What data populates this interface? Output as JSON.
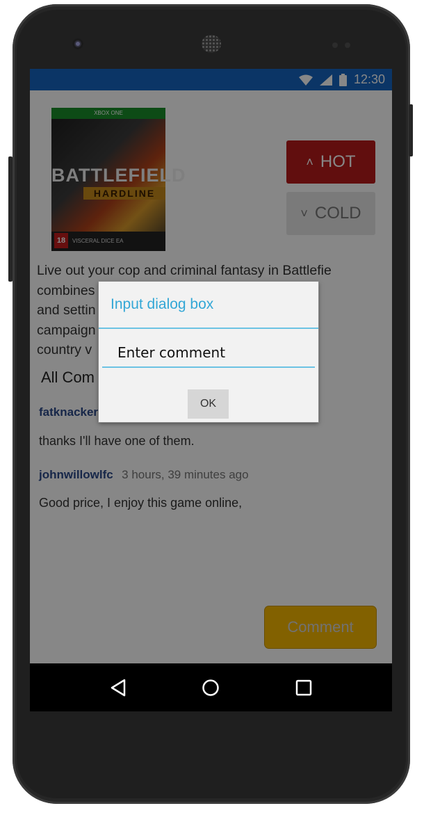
{
  "status_bar": {
    "time": "12:30",
    "icons": [
      "wifi-icon",
      "signal-icon",
      "battery-icon"
    ],
    "color": "#1565c0"
  },
  "product": {
    "cover": {
      "platform": "XBOX ONE",
      "title": "BATTLEFIELD",
      "subtitle": "HARDLINE",
      "rating": "18",
      "publishers": "VISCERAL  DICE  EA"
    },
    "hot_label": "HOT",
    "cold_label": "COLD",
    "description_lines": [
      "Live out your cop and criminal fantasy in Battlefie",
      "combines                                    ments",
      "and settin                                   ion cri",
      "campaign                                    oza, a",
      "country v                                    once t"
    ]
  },
  "comments": {
    "heading": "All Com",
    "items": [
      {
        "user": "fatknacker",
        "time": "",
        "text": "thanks I'll have one of them."
      },
      {
        "user": "johnwillowlfc",
        "time": "3 hours, 39 minutes ago",
        "text": "Good price, I enjoy this game online,"
      }
    ],
    "comment_button": "Comment"
  },
  "dialog": {
    "title": "Input dialog box",
    "input_placeholder": "Enter comment",
    "ok_label": "OK"
  },
  "nav": {
    "back": "back-icon",
    "home": "home-icon",
    "recents": "recents-icon"
  },
  "colors": {
    "hot": "#b71c1c",
    "cold": "#e6e6e6",
    "comment_button": "#f6b700",
    "dialog_accent": "#33a7d6"
  }
}
